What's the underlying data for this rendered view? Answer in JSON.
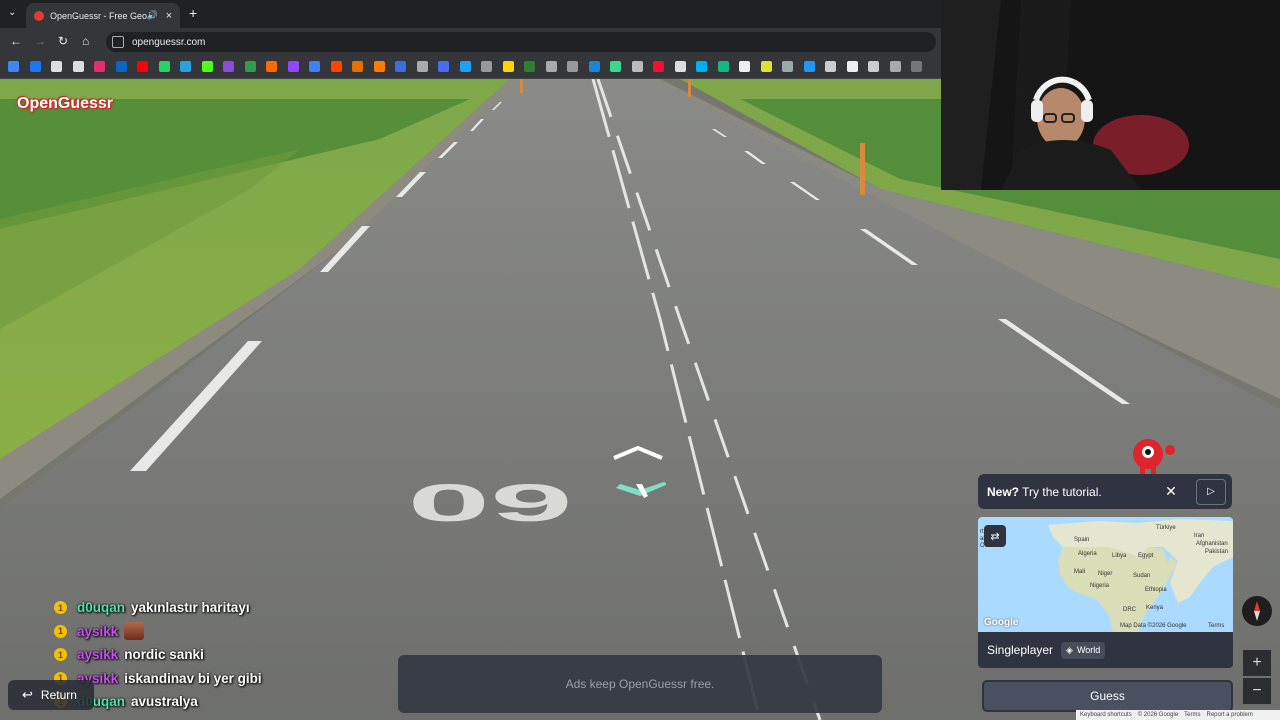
{
  "browser": {
    "tab_title": "OpenGuessr - Free GeoGuessr",
    "url": "openguessr.com",
    "new_tab_symbol": "+",
    "close_symbol": "×"
  },
  "app": {
    "logo_text": "OpenGuessr",
    "ads_text": "Ads keep OpenGuessr free.",
    "return_label": "Return",
    "tutorial": {
      "new": "New?",
      "text": "Try the tutorial."
    },
    "mode": {
      "label": "Singleplayer",
      "map_name": "World"
    },
    "guess_label": "Guess",
    "zoom_in": "+",
    "zoom_out": "−"
  },
  "road": {
    "speed_marking": "60"
  },
  "map": {
    "attribution": "Map Data ©2026 Google",
    "terms": "Terms",
    "google_logo": "Google",
    "labels": {
      "spain": "Spain",
      "turkiye": "Türkiye",
      "algeria": "Algeria",
      "libya": "Libya",
      "egypt": "Egypt",
      "iran": "Iran",
      "afghanistan": "Afghanistan",
      "pakistan": "Pakistan",
      "mali": "Mali",
      "niger": "Niger",
      "sudan": "Sudan",
      "nigeria": "Nigeria",
      "ethiopia": "Ethiopia",
      "drc": "DRC",
      "kenya": "Kenya",
      "ocean1": "rth",
      "ocean2": "antic",
      "ocean3": "Ocean"
    }
  },
  "chat": [
    {
      "user": "d0uqan",
      "color": "green",
      "message": "yakınlastır haritayı",
      "emote": false
    },
    {
      "user": "aysikk",
      "color": "purple",
      "message": "",
      "emote": true
    },
    {
      "user": "aysikk",
      "color": "purple",
      "message": "nordic sanki",
      "emote": false
    },
    {
      "user": "aysikk",
      "color": "purple",
      "message": "iskandinav bi yer gibi",
      "emote": false
    },
    {
      "user": "d0uqan",
      "color": "green",
      "message": "avustralya",
      "emote": false
    }
  ],
  "footer": {
    "shortcuts": "Keyboard shortcuts",
    "copyright": "© 2026 Google",
    "terms": "Terms",
    "report": "Report a problem"
  }
}
